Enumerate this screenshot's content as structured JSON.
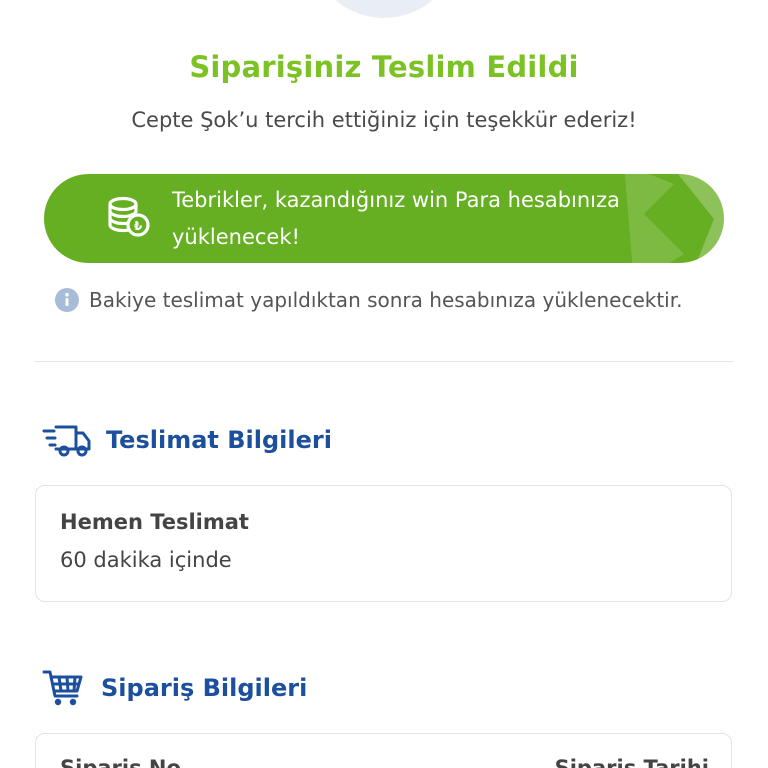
{
  "header": {
    "title": "Siparişiniz Teslim Edildi",
    "subtitle": "Cepte Şok’u tercih ettiğiniz için teşekkür ederiz!"
  },
  "banner": {
    "line1": "Tebrikler, kazandığınız win Para hesabınıza",
    "line2": "yüklenecek!",
    "icon": "coins-icon",
    "background_color": "#66ae22"
  },
  "info": {
    "text": "Bakiye teslimat yapıldıktan sonra hesabınıza yüklenecektir.",
    "icon": "info-icon"
  },
  "delivery": {
    "section_title": "Teslimat Bilgileri",
    "icon": "truck-icon",
    "type": "Hemen Teslimat",
    "time": "60 dakika içinde"
  },
  "order": {
    "section_title": "Sipariş Bilgileri",
    "icon": "cart-icon",
    "left_label": "Sipariş No",
    "right_label": "Sipariş Tarihi"
  },
  "colors": {
    "accent_green": "#7cc224",
    "brand_blue": "#1c4f9c"
  }
}
